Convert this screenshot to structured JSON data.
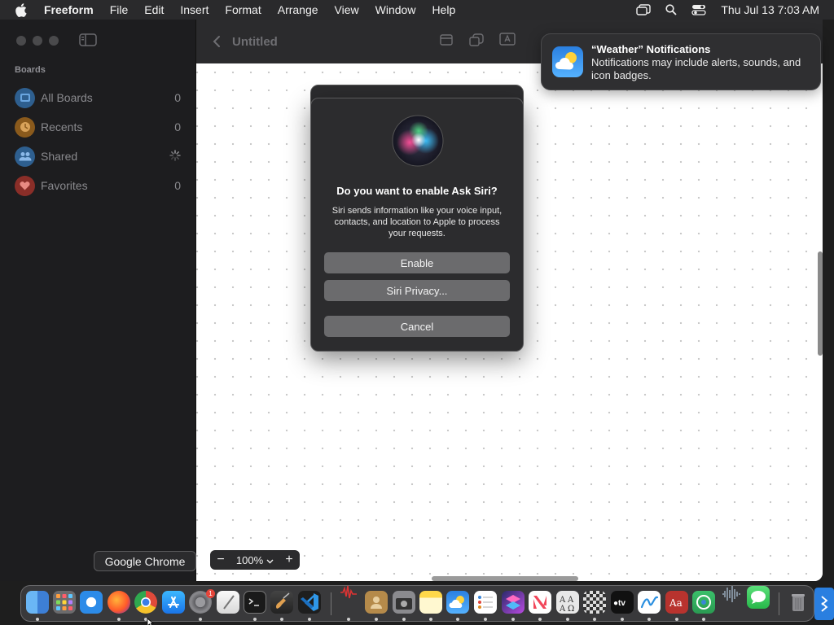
{
  "menubar": {
    "app_name": "Freeform",
    "items": [
      "File",
      "Edit",
      "Insert",
      "Format",
      "Arrange",
      "View",
      "Window",
      "Help"
    ],
    "clock": "Thu Jul 13  7:03 AM"
  },
  "toolbar": {
    "doc_title": "Untitled"
  },
  "sidebar": {
    "heading": "Boards",
    "items": [
      {
        "label": "All Boards",
        "count": "0",
        "icon": "all-boards-icon",
        "color": "#3a86d8"
      },
      {
        "label": "Recents",
        "count": "0",
        "icon": "clock-icon",
        "color": "#e08a1f"
      },
      {
        "label": "Shared",
        "count": "",
        "icon": "people-icon",
        "color": "#3a86d8"
      },
      {
        "label": "Favorites",
        "count": "0",
        "icon": "heart-icon",
        "color": "#e0453a"
      }
    ]
  },
  "zoom": {
    "minus": "−",
    "value": "100%",
    "plus": "+"
  },
  "dialog": {
    "title": "Do you want to enable Ask Siri?",
    "body": "Siri sends information like your voice input, contacts, and location to Apple to process your requests.",
    "enable_label": "Enable",
    "privacy_label": "Siri Privacy...",
    "cancel_label": "Cancel"
  },
  "notification": {
    "title": "“Weather” Notifications",
    "body": "Notifications may include alerts, sounds, and icon badges."
  },
  "dock": {
    "tooltip": "Google Chrome",
    "badge_count": "1"
  },
  "colors": {
    "dialog_bg": "#2c2c2e",
    "button_bg": "#6b6b6d",
    "menubar_bg": "#2a2a2c",
    "sidebar_bg": "#1d1d1f"
  }
}
